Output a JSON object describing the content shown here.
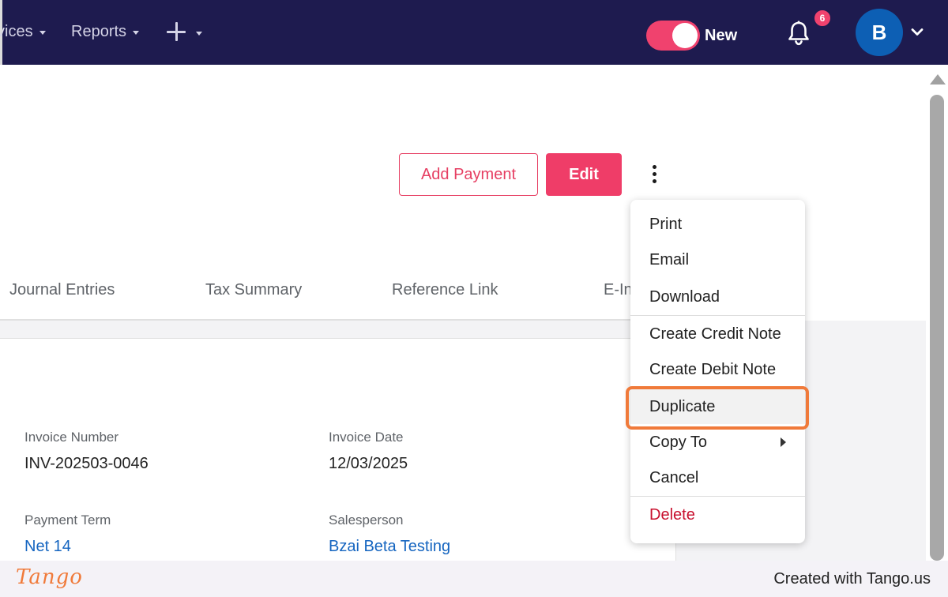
{
  "nav": {
    "items": [
      {
        "label": "vices"
      },
      {
        "label": "Reports"
      }
    ],
    "toggle_label": "New",
    "notification_count": "6",
    "avatar_initial": "B"
  },
  "actions": {
    "add_payment_label": "Add Payment",
    "edit_label": "Edit"
  },
  "tabs": [
    "Journal Entries",
    "Tax Summary",
    "Reference Link",
    "E-In"
  ],
  "invoice": {
    "invoice_number_label": "Invoice Number",
    "invoice_number": "INV-202503-0046",
    "invoice_date_label": "Invoice Date",
    "invoice_date": "12/03/2025",
    "payment_term_label": "Payment Term",
    "payment_term": "Net 14",
    "salesperson_label": "Salesperson",
    "salesperson": "Bzai Beta Testing"
  },
  "menu": {
    "items": [
      {
        "label": "Print"
      },
      {
        "label": "Email"
      },
      {
        "label": "Download"
      },
      {
        "label": "Create Credit Note"
      },
      {
        "label": "Create Debit Note"
      },
      {
        "label": "Duplicate",
        "highlighted": true
      },
      {
        "label": "Copy To",
        "has_submenu": true
      },
      {
        "label": "Cancel"
      },
      {
        "label": "Delete",
        "danger": true
      }
    ]
  },
  "footer": {
    "logo": "Tango",
    "credit": "Created with Tango.us"
  },
  "colors": {
    "nav_bg": "#1e1b4f",
    "accent": "#ef3d68",
    "highlight": "#f07a3a",
    "avatar": "#0d5fb4",
    "link": "#1565c0",
    "danger": "#c8102e"
  },
  "icons": {
    "bell": "bell-icon",
    "plus": "plus-icon",
    "kebab": "more-vertical-icon",
    "avatar_caret": "chevron-down-icon"
  }
}
